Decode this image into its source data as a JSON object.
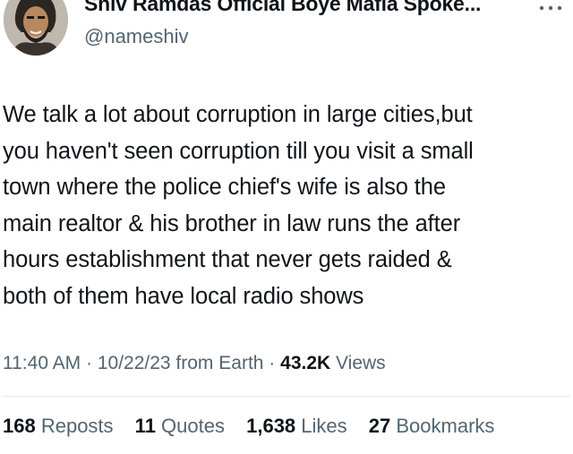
{
  "author": {
    "display_name": "Shiv Ramdas Official Boye Mafia Spoke...",
    "handle": "@nameshiv",
    "avatar_icon": "avatar-photo"
  },
  "more_icon": "more-horizontal-icon",
  "tweet": {
    "lines": [
      "We talk a lot about corruption in large cities,but",
      "you haven't seen corruption till you visit a small",
      "town where the police chief's wife is also the",
      "main realtor & his brother in law runs the  after",
      "hours establishment that never gets raided &",
      "both of them have local radio shows"
    ]
  },
  "meta": {
    "time": "11:40 AM",
    "sep1": " · ",
    "date": "10/22/23",
    "source": " from Earth",
    "sep2": " · ",
    "views_count": "43.2K",
    "views_label": " Views"
  },
  "stats": {
    "reposts_count": "168",
    "reposts_label": " Reposts",
    "quotes_count": "11",
    "quotes_label": " Quotes",
    "likes_count": "1,638",
    "likes_label": " Likes",
    "bookmarks_count": "27",
    "bookmarks_label": " Bookmarks"
  },
  "colors": {
    "text_primary": "#0f1419",
    "text_secondary": "#536471",
    "divider": "#e6e9eb"
  }
}
